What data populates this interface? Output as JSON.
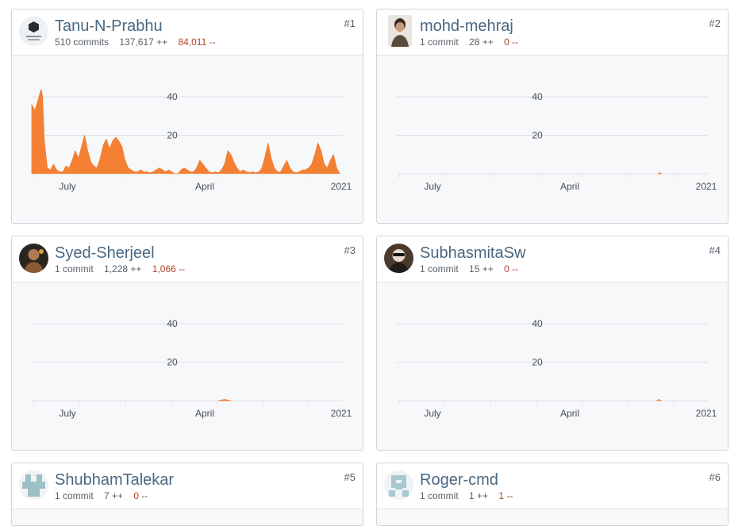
{
  "contributors": [
    {
      "rank": "#1",
      "name": "Tanu-N-Prabhu",
      "commits": "510 commits",
      "additions": "137,617 ++",
      "deletions": "84,011 --",
      "avatar_icon": "hexagon-logo-avatar-icon"
    },
    {
      "rank": "#2",
      "name": "mohd-mehraj",
      "commits": "1 commit",
      "additions": "28 ++",
      "deletions": "0 --",
      "avatar_icon": "person-photo-avatar-icon"
    },
    {
      "rank": "#3",
      "name": "Syed-Sherjeel",
      "commits": "1 commit",
      "additions": "1,228 ++",
      "deletions": "1,066 --",
      "avatar_icon": "person-photo-avatar-icon"
    },
    {
      "rank": "#4",
      "name": "SubhasmitaSw",
      "commits": "1 commit",
      "additions": "15 ++",
      "deletions": "0 --",
      "avatar_icon": "person-photo-avatar-icon"
    },
    {
      "rank": "#5",
      "name": "ShubhamTalekar",
      "commits": "1 commit",
      "additions": "7 ++",
      "deletions": "0 --",
      "avatar_icon": "identicon-avatar-icon"
    },
    {
      "rank": "#6",
      "name": "Roger-cmd",
      "commits": "1 commit",
      "additions": "1 ++",
      "deletions": "1 --",
      "avatar_icon": "identicon-avatar-icon"
    }
  ],
  "colors": {
    "area": "#f38033",
    "grid": "#dde1e5",
    "deletions": "#b0422a",
    "name": "#4a6782"
  },
  "chart_data": [
    {
      "type": "area",
      "contributor": "Tanu-N-Prabhu",
      "y_ticks": [
        20,
        40
      ],
      "ylim": [
        0,
        47
      ],
      "x_ticks": [
        "July",
        "April",
        "2021"
      ],
      "x": [
        0,
        0.01,
        0.02,
        0.03,
        0.035,
        0.04,
        0.05,
        0.06,
        0.07,
        0.08,
        0.09,
        0.1,
        0.11,
        0.12,
        0.13,
        0.14,
        0.15,
        0.16,
        0.17,
        0.18,
        0.19,
        0.2,
        0.21,
        0.22,
        0.23,
        0.24,
        0.25,
        0.26,
        0.27,
        0.28,
        0.29,
        0.3,
        0.31,
        0.32,
        0.33,
        0.34,
        0.35,
        0.36,
        0.37,
        0.38,
        0.39,
        0.4,
        0.41,
        0.42,
        0.43,
        0.44,
        0.45,
        0.46,
        0.47,
        0.48,
        0.49,
        0.5,
        0.51,
        0.52,
        0.53,
        0.54,
        0.55,
        0.56,
        0.57,
        0.58,
        0.59,
        0.6,
        0.61,
        0.62,
        0.63,
        0.64,
        0.65,
        0.66,
        0.67,
        0.68,
        0.69,
        0.7,
        0.71,
        0.72,
        0.73,
        0.74,
        0.75,
        0.76,
        0.77,
        0.78,
        0.79,
        0.8,
        0.81,
        0.82,
        0.83,
        0.84,
        0.85,
        0.86,
        0.87,
        0.88,
        0.89,
        0.9,
        0.91,
        0.92,
        0.93,
        0.94,
        0.95,
        0.96,
        0.97,
        0.98,
        0.99,
        1
      ],
      "y": [
        36,
        33,
        38,
        44,
        40,
        18,
        3,
        2,
        5,
        2,
        1,
        1,
        4,
        3,
        7,
        12,
        8,
        14,
        20,
        12,
        6,
        4,
        3,
        8,
        15,
        18,
        13,
        17,
        19,
        17,
        14,
        7,
        3,
        2,
        1,
        1,
        2,
        1,
        1,
        0.5,
        1,
        2,
        3,
        2,
        1,
        2,
        1,
        0,
        0,
        2,
        3,
        2,
        1,
        1,
        3,
        7,
        5,
        3,
        1,
        0.5,
        1,
        0.5,
        2,
        5,
        12,
        10,
        6,
        3,
        1,
        2,
        1,
        0.5,
        1,
        0.5,
        1,
        3,
        9,
        16,
        8,
        3,
        1,
        1,
        4,
        7,
        3,
        1,
        0.5,
        1,
        2,
        2,
        3,
        5,
        10,
        16,
        12,
        5,
        3,
        7,
        10,
        3,
        0
      ]
    },
    {
      "type": "area",
      "contributor": "mohd-mehraj",
      "y_ticks": [
        20,
        40
      ],
      "ylim": [
        0,
        47
      ],
      "x_ticks": [
        "July",
        "April",
        "2021"
      ],
      "x": [
        0.84,
        0.845,
        0.85
      ],
      "y": [
        0,
        0.6,
        0
      ]
    },
    {
      "type": "area",
      "contributor": "Syed-Sherjeel",
      "y_ticks": [
        20,
        40
      ],
      "ylim": [
        0,
        47
      ],
      "x_ticks": [
        "July",
        "April",
        "2021"
      ],
      "x": [
        0.6,
        0.62,
        0.64
      ],
      "y": [
        0,
        0.6,
        0
      ]
    },
    {
      "type": "area",
      "contributor": "SubhasmitaSw",
      "y_ticks": [
        20,
        40
      ],
      "ylim": [
        0,
        47
      ],
      "x_ticks": [
        "July",
        "April",
        "2021"
      ],
      "x": [
        0.835,
        0.842,
        0.85
      ],
      "y": [
        0,
        0.6,
        0
      ]
    }
  ]
}
